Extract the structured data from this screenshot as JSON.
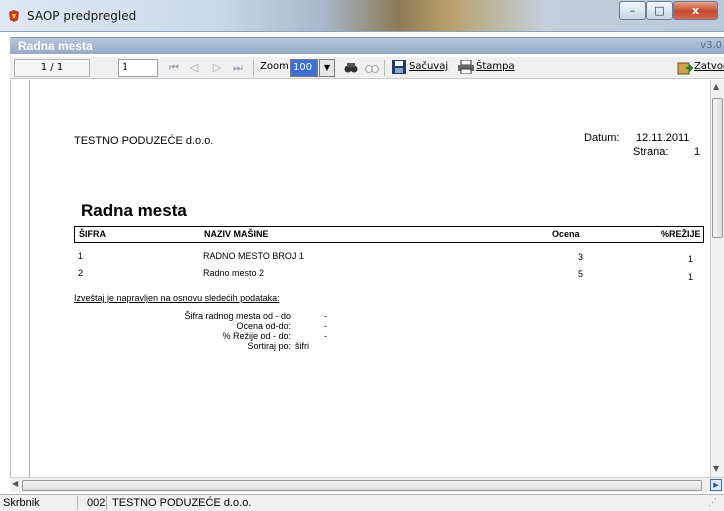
{
  "window": {
    "title": "SAOP predpregled",
    "minimize": "–",
    "maximize": "□",
    "close": "x"
  },
  "header": {
    "title": "Radna mesta",
    "version": "v3.0"
  },
  "toolbar": {
    "page_indicator": "1 / 1",
    "page_input": "1",
    "zoom_label": "Zoom:",
    "zoom_value": "100",
    "save_label": "Sačuvaj",
    "print_label": "Štampa",
    "close_label": "Zatvori"
  },
  "report": {
    "company": "TESTNO PODUZEĆE d.o.o.",
    "datum_label": "Datum:",
    "datum_value": "12.11.2011",
    "strana_label": "Strana:",
    "strana_value": "1",
    "title": "Radna mesta",
    "columns": [
      "ŠIFRA",
      "NAZIV MAŠINE",
      "Ocena",
      "%REŽIJE"
    ],
    "rows": [
      {
        "sifra": "1",
        "naziv": "RADNO MESTO BROJ 1",
        "ocena": "3",
        "rezije": "1"
      },
      {
        "sifra": "2",
        "naziv": "Radno mesto 2",
        "ocena": "5",
        "rezije": "1"
      }
    ],
    "note": "Izveštaj je napravljen na osnovu sledećih podataka:",
    "params": [
      {
        "label": "Šifra radnog mesta od - do",
        "value": "-"
      },
      {
        "label": "Ocena od-do:",
        "value": "-"
      },
      {
        "label": "% Režije od - do:",
        "value": "-"
      },
      {
        "label": "Sortiraj po:",
        "value": "šifri"
      }
    ]
  },
  "statusbar": {
    "label": "Skrbnik",
    "code": "002",
    "company": "TESTNO PODUZEĆE d.o.o."
  }
}
